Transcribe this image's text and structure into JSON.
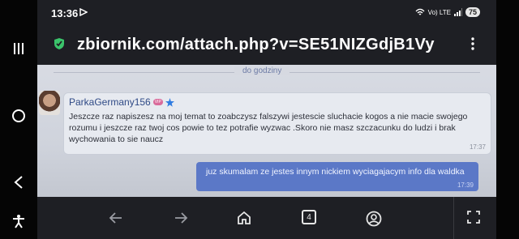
{
  "status": {
    "time": "13:36",
    "network": "Vo) LTE",
    "battery": "75"
  },
  "browser": {
    "url": "zbiornik.com/attach.php?v=SE51NIZGdjB1Vy",
    "tab_count": "4"
  },
  "chat": {
    "date_separator": "do godziny",
    "incoming": {
      "sender": "ParkaGermany156",
      "badge": "VIP",
      "text": "Jeszcze raz napiszesz na moj temat to zoabczysz falszywi jestescie sluchacie kogos a nie macie swojego rozumu i jeszcze raz twoj cos powie to tez potrafie wyzwac .Skoro nie masz szczacunku do ludzi i brak wychowania to sie naucz",
      "time": "17:37"
    },
    "outgoing": {
      "text": "juz skumalam ze jestes innym nickiem wyciagajacym info dla waldka",
      "time": "17:39"
    }
  },
  "colors": {
    "incoming_bubble": "#e7eaf0",
    "outgoing_bubble": "#5b78c7",
    "verified_star": "#2f7be0",
    "shield": "#3bc46b"
  },
  "icons": [
    "recent-apps-icon",
    "home-circle-icon",
    "back-icon",
    "accessibility-icon",
    "play-icon",
    "wifi-icon",
    "signal-icon",
    "shield-icon",
    "menu-dots-icon",
    "vip-badge-icon",
    "star-icon",
    "arrow-back-icon",
    "arrow-forward-icon",
    "home-icon",
    "tabs-icon",
    "account-icon",
    "fullscreen-icon"
  ]
}
